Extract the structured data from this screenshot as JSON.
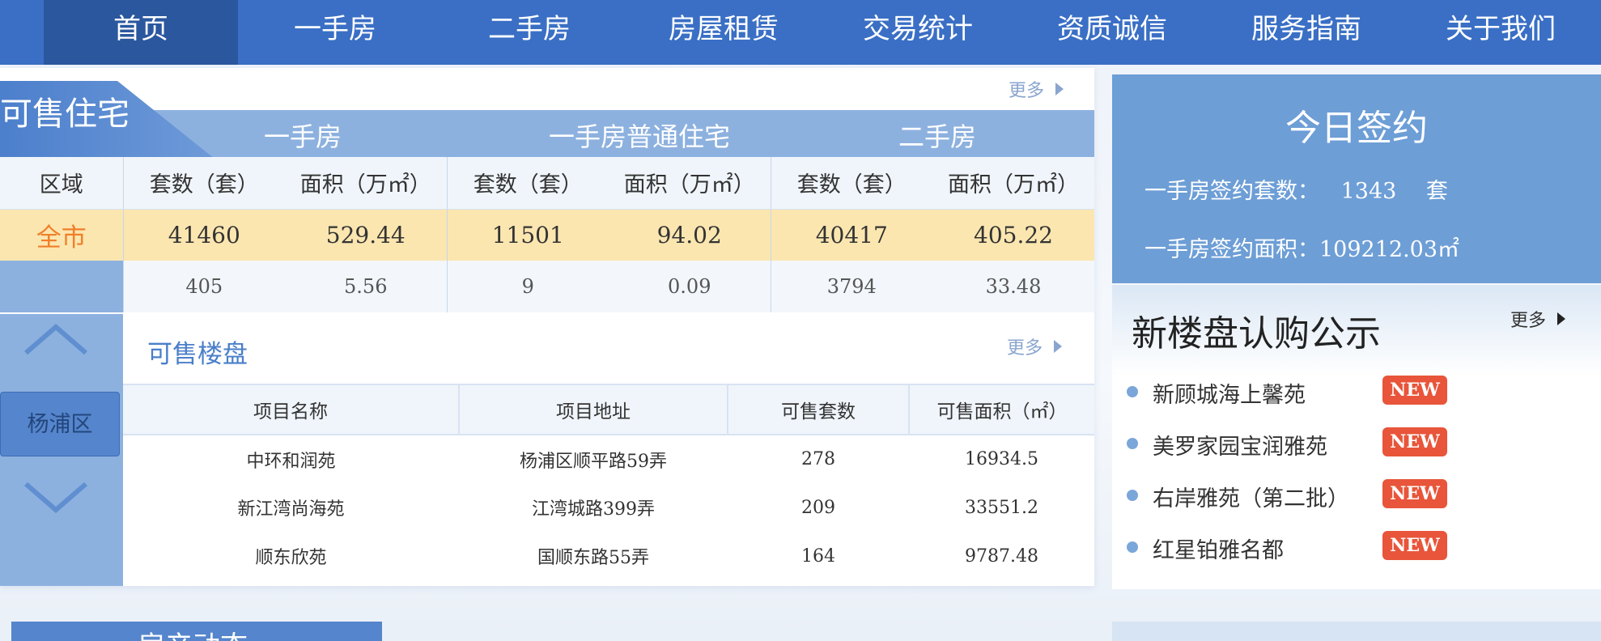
{
  "nav": {
    "items": [
      "首页",
      "一手房",
      "二手房",
      "房屋租赁",
      "交易统计",
      "资质诚信",
      "服务指南",
      "关于我们"
    ]
  },
  "sales_panel": {
    "tab_title": "可售住宅",
    "more_label": "更多",
    "groups": [
      "一手房",
      "一手房普通住宅",
      "二手房"
    ],
    "columns": [
      "区域",
      "套数（套）",
      "面积（万㎡）",
      "套数（套）",
      "面积（万㎡）",
      "套数（套）",
      "面积（万㎡）"
    ],
    "citywide": {
      "label": "全市",
      "values": [
        "41460",
        "529.44",
        "11501",
        "94.02",
        "40417",
        "405.22"
      ]
    },
    "district": {
      "label": "杨浦区",
      "values": [
        "405",
        "5.56",
        "9",
        "0.09",
        "3794",
        "33.48"
      ]
    }
  },
  "projects": {
    "title": "可售楼盘",
    "more_label": "更多",
    "headers": [
      "项目名称",
      "项目地址",
      "可售套数",
      "可售面积（㎡）"
    ],
    "rows": [
      [
        "中环和润苑",
        "杨浦区顺平路59弄",
        "278",
        "16934.5"
      ],
      [
        "新江湾尚海苑",
        "江湾城路399弄",
        "209",
        "33551.2"
      ],
      [
        "顺东欣苑",
        "国顺东路55弄",
        "164",
        "9787.48"
      ]
    ]
  },
  "today_sign": {
    "title": "今日签约",
    "count_label": "一手房签约套数：",
    "count_value": "1343",
    "count_unit": "套",
    "area_label": "一手房签约面积：",
    "area_value": "109212.03㎡"
  },
  "new_listings": {
    "title": "新楼盘认购公示",
    "more_label": "更多",
    "badge": "NEW",
    "items": [
      "新顾城海上馨苑",
      "美罗家园宝润雅苑",
      "右岸雅苑（第二批）",
      "红星铂雅名都"
    ]
  },
  "bottom": {
    "left_title": "房产动态"
  },
  "colors": {
    "nav_bg": "#3a6fc5",
    "nav_active": "#2b579f",
    "accent_blue": "#8db1df",
    "citywide_row": "#fbe6b0",
    "citywide_text": "#f07f2a",
    "new_badge": "#e8553a"
  }
}
